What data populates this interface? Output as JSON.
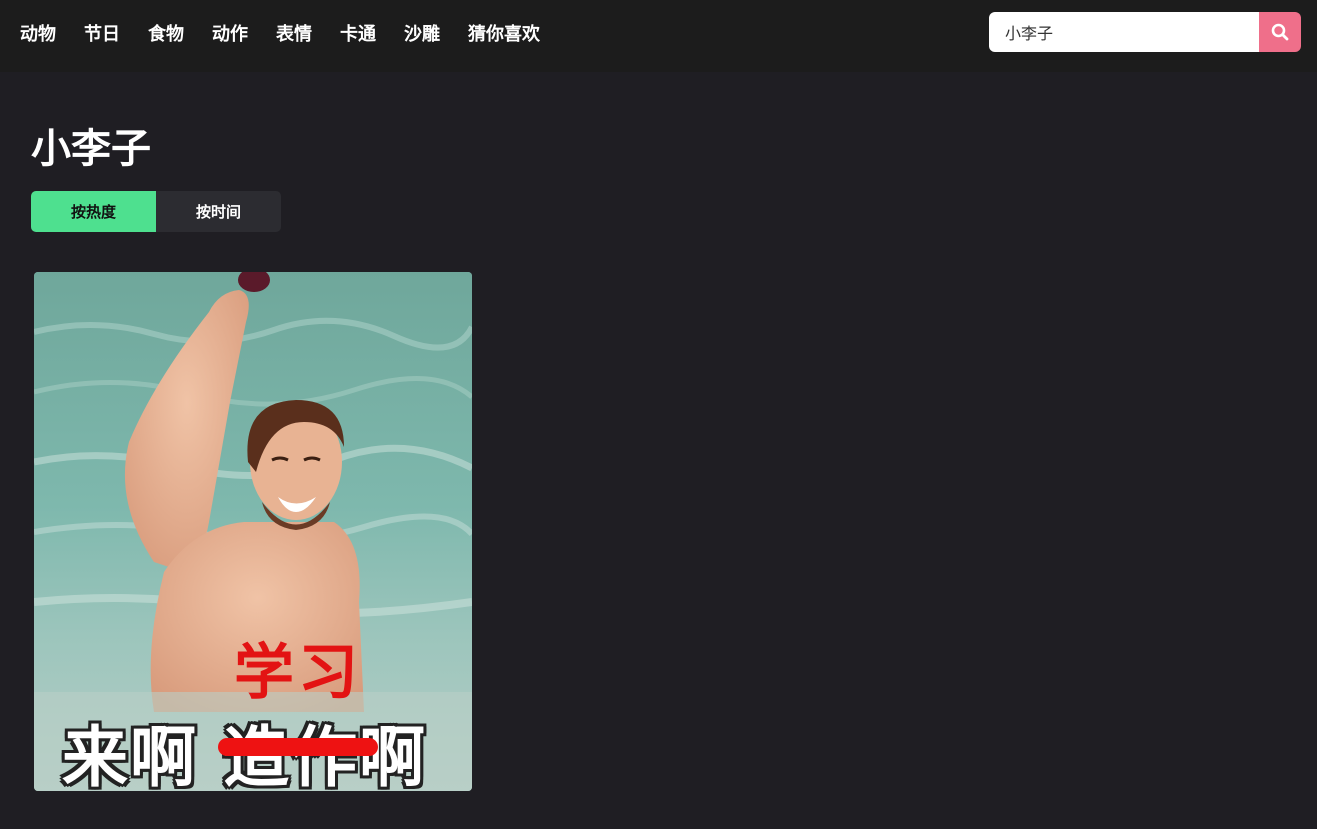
{
  "nav": {
    "items": [
      {
        "label": "动物"
      },
      {
        "label": "节日"
      },
      {
        "label": "食物"
      },
      {
        "label": "动作"
      },
      {
        "label": "表情"
      },
      {
        "label": "卡通"
      },
      {
        "label": "沙雕"
      },
      {
        "label": "猜你喜欢"
      }
    ]
  },
  "search": {
    "value": "小李子",
    "button_icon": "search-icon",
    "button_color": "#ef6f8a"
  },
  "page": {
    "title": "小李子"
  },
  "sort": {
    "tabs": [
      {
        "label": "按热度",
        "active": true
      },
      {
        "label": "按时间",
        "active": false
      }
    ],
    "active_color": "#4ee08f"
  },
  "results": [
    {
      "caption_top": "学习",
      "caption_bottom": "来啊 造作啊"
    }
  ],
  "colors": {
    "background": "#1f1e23",
    "topbar": "#1c1c1c"
  }
}
